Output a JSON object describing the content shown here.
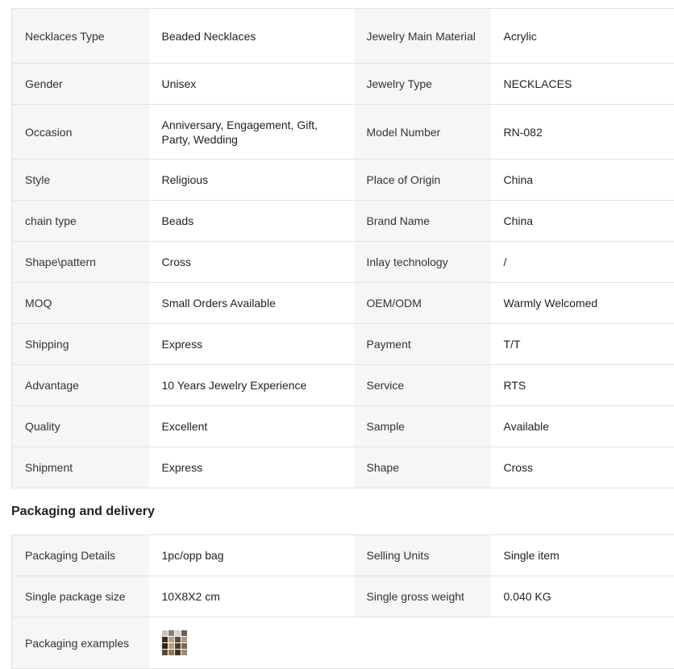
{
  "specs": [
    [
      "Necklaces Type",
      "Beaded Necklaces",
      "Jewelry Main Material",
      "Acrylic"
    ],
    [
      "Gender",
      "Unisex",
      "Jewelry Type",
      "NECKLACES"
    ],
    [
      "Occasion",
      "Anniversary, Engagement, Gift, Party, Wedding",
      "Model Number",
      "RN-082"
    ],
    [
      "Style",
      "Religious",
      "Place of Origin",
      "China"
    ],
    [
      "chain type",
      "Beads",
      "Brand Name",
      "China"
    ],
    [
      "Shape\\pattern",
      "Cross",
      "Inlay technology",
      "/"
    ],
    [
      "MOQ",
      "Small Orders Available",
      "OEM/ODM",
      "Warmly Welcomed"
    ],
    [
      "Shipping",
      "Express",
      "Payment",
      "T/T"
    ],
    [
      "Advantage",
      "10 Years Jewelry Experience",
      "Service",
      "RTS"
    ],
    [
      "Quality",
      "Excellent",
      "Sample",
      "Available"
    ],
    [
      "Shipment",
      "Express",
      "Shape",
      "Cross"
    ]
  ],
  "packaging": {
    "title": "Packaging and delivery",
    "rows": [
      [
        "Packaging Details",
        "1pc/opp bag",
        "Selling Units",
        "Single item"
      ],
      [
        "Single package size",
        "10X8X2 cm",
        "Single gross weight",
        "0.040 KG"
      ]
    ],
    "examples_label": "Packaging examples"
  }
}
